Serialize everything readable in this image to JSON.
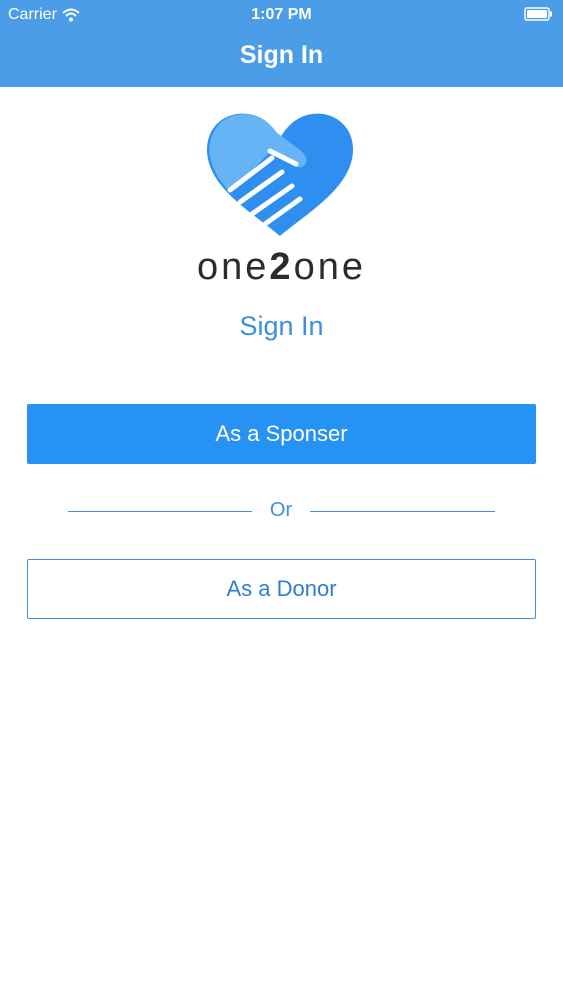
{
  "status_bar": {
    "carrier": "Carrier",
    "time": "1:07 PM",
    "wifi_icon": "wifi-icon",
    "battery_icon": "battery-icon"
  },
  "nav": {
    "title": "Sign In",
    "background_color": "#4a9de6"
  },
  "logo": {
    "icon": "heart-handshake-logo",
    "brand_prefix": "one",
    "brand_number": "2",
    "brand_suffix": "one"
  },
  "main": {
    "subtitle": "Sign In",
    "sponsor_button_label": "As a Sponser",
    "divider_label": "Or",
    "donor_button_label": "As a Donor"
  },
  "colors": {
    "accent": "#2592f4",
    "text_blue": "#3d8fdc"
  }
}
